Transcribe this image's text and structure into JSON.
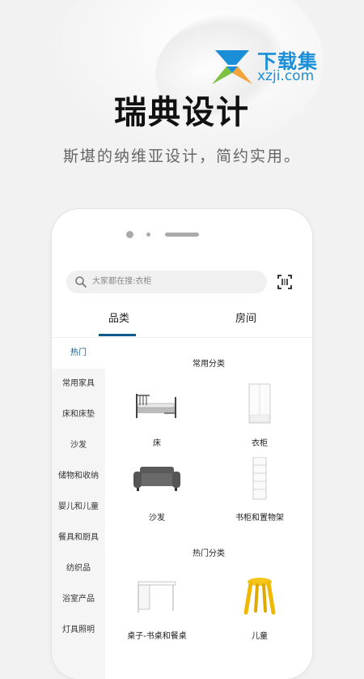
{
  "watermark": {
    "title": "下载集",
    "url": "xzji.com"
  },
  "hero": {
    "title": "瑞典设计",
    "subtitle": "斯堪的纳维亚设计，简约实用。"
  },
  "search": {
    "placeholder": "大家都在搜:衣柜"
  },
  "tabs": [
    {
      "label": "品类"
    },
    {
      "label": "房间"
    }
  ],
  "sidebar": {
    "items": [
      {
        "label": "热门"
      },
      {
        "label": "常用家具"
      },
      {
        "label": "床和床垫"
      },
      {
        "label": "沙发"
      },
      {
        "label": "储物和收纳"
      },
      {
        "label": "婴儿和儿童"
      },
      {
        "label": "餐具和厨具"
      },
      {
        "label": "纺织品"
      },
      {
        "label": "浴室产品"
      },
      {
        "label": "灯具照明"
      }
    ]
  },
  "sections": {
    "common": {
      "title": "常用分类",
      "items": [
        {
          "label": "床",
          "icon": "bed-icon"
        },
        {
          "label": "衣柜",
          "icon": "wardrobe-icon"
        },
        {
          "label": "沙发",
          "icon": "sofa-icon"
        },
        {
          "label": "书柜和置物架",
          "icon": "bookshelf-icon"
        }
      ]
    },
    "hot": {
      "title": "热门分类",
      "items": [
        {
          "label": "桌子-书桌和餐桌",
          "icon": "desk-icon"
        },
        {
          "label": "儿童",
          "icon": "kids-stool-icon"
        }
      ]
    }
  },
  "colors": {
    "accent": "#0b5a8e",
    "watermark": "#1a8fd8"
  }
}
